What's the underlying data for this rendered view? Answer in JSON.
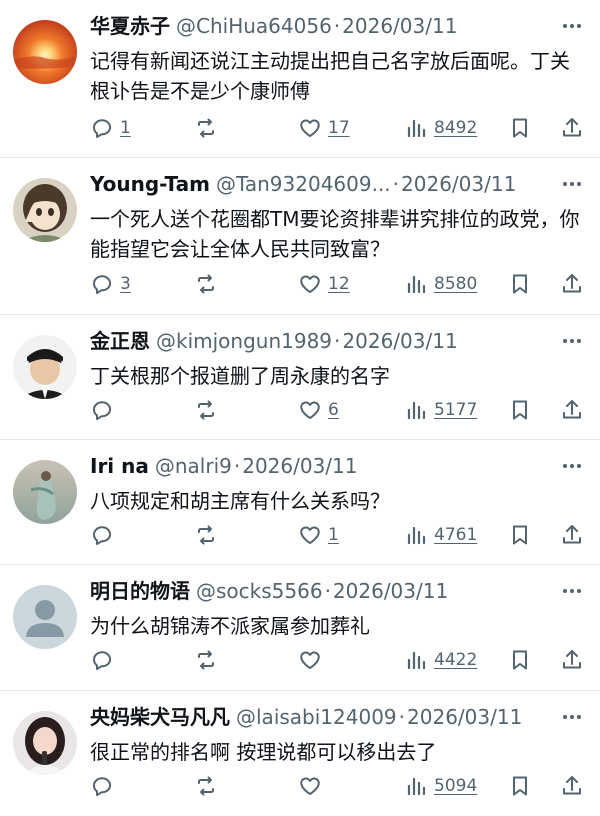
{
  "tweets": [
    {
      "name": "华夏赤子",
      "handle": "@ChiHua64056",
      "sep": "·",
      "date": "2026/03/11",
      "text": "记得有新闻还说江主动提出把自己名字放后面呢。丁关根讣告是不是少个康师傅",
      "replies": "1",
      "retweets": "",
      "likes": "17",
      "views": "8492",
      "avatar": "sunset-avatar"
    },
    {
      "name": "Young-Tam",
      "handle": "@Tan93204609...",
      "sep": "·",
      "date": "2026/03/11",
      "text": "一个死人送个花圈都TM要论资排辈讲究排位的政党，你能指望它会让全体人民共同致富？",
      "replies": "3",
      "retweets": "",
      "likes": "12",
      "views": "8580",
      "avatar": "anime-avatar"
    },
    {
      "name": "金正恩",
      "handle": "@kimjongun1989",
      "sep": "·",
      "date": "2026/03/11",
      "text": "丁关根那个报道删了周永康的名字",
      "replies": "",
      "retweets": "",
      "likes": "6",
      "views": "5177",
      "avatar": "portrait-avatar"
    },
    {
      "name": "Iri na",
      "handle": "@nalri9",
      "sep": "·",
      "date": "2026/03/11",
      "text": "八项规定和胡主席有什么关系吗？",
      "replies": "",
      "retweets": "",
      "likes": "1",
      "views": "4761",
      "avatar": "painting-avatar"
    },
    {
      "name": "明日的物语",
      "handle": "@socks5566",
      "sep": "·",
      "date": "2026/03/11",
      "text": "为什么胡锦涛不派家属参加葬礼",
      "replies": "",
      "retweets": "",
      "likes": "",
      "views": "4422",
      "avatar": "default-avatar"
    },
    {
      "name": "央妈柴犬马凡凡",
      "handle": "@laisabi124009",
      "sep": "·",
      "date": "2026/03/11",
      "text": "很正常的排名啊 按理说都可以移出去了",
      "replies": "",
      "retweets": "",
      "likes": "",
      "views": "5094",
      "avatar": "woman-avatar"
    }
  ]
}
